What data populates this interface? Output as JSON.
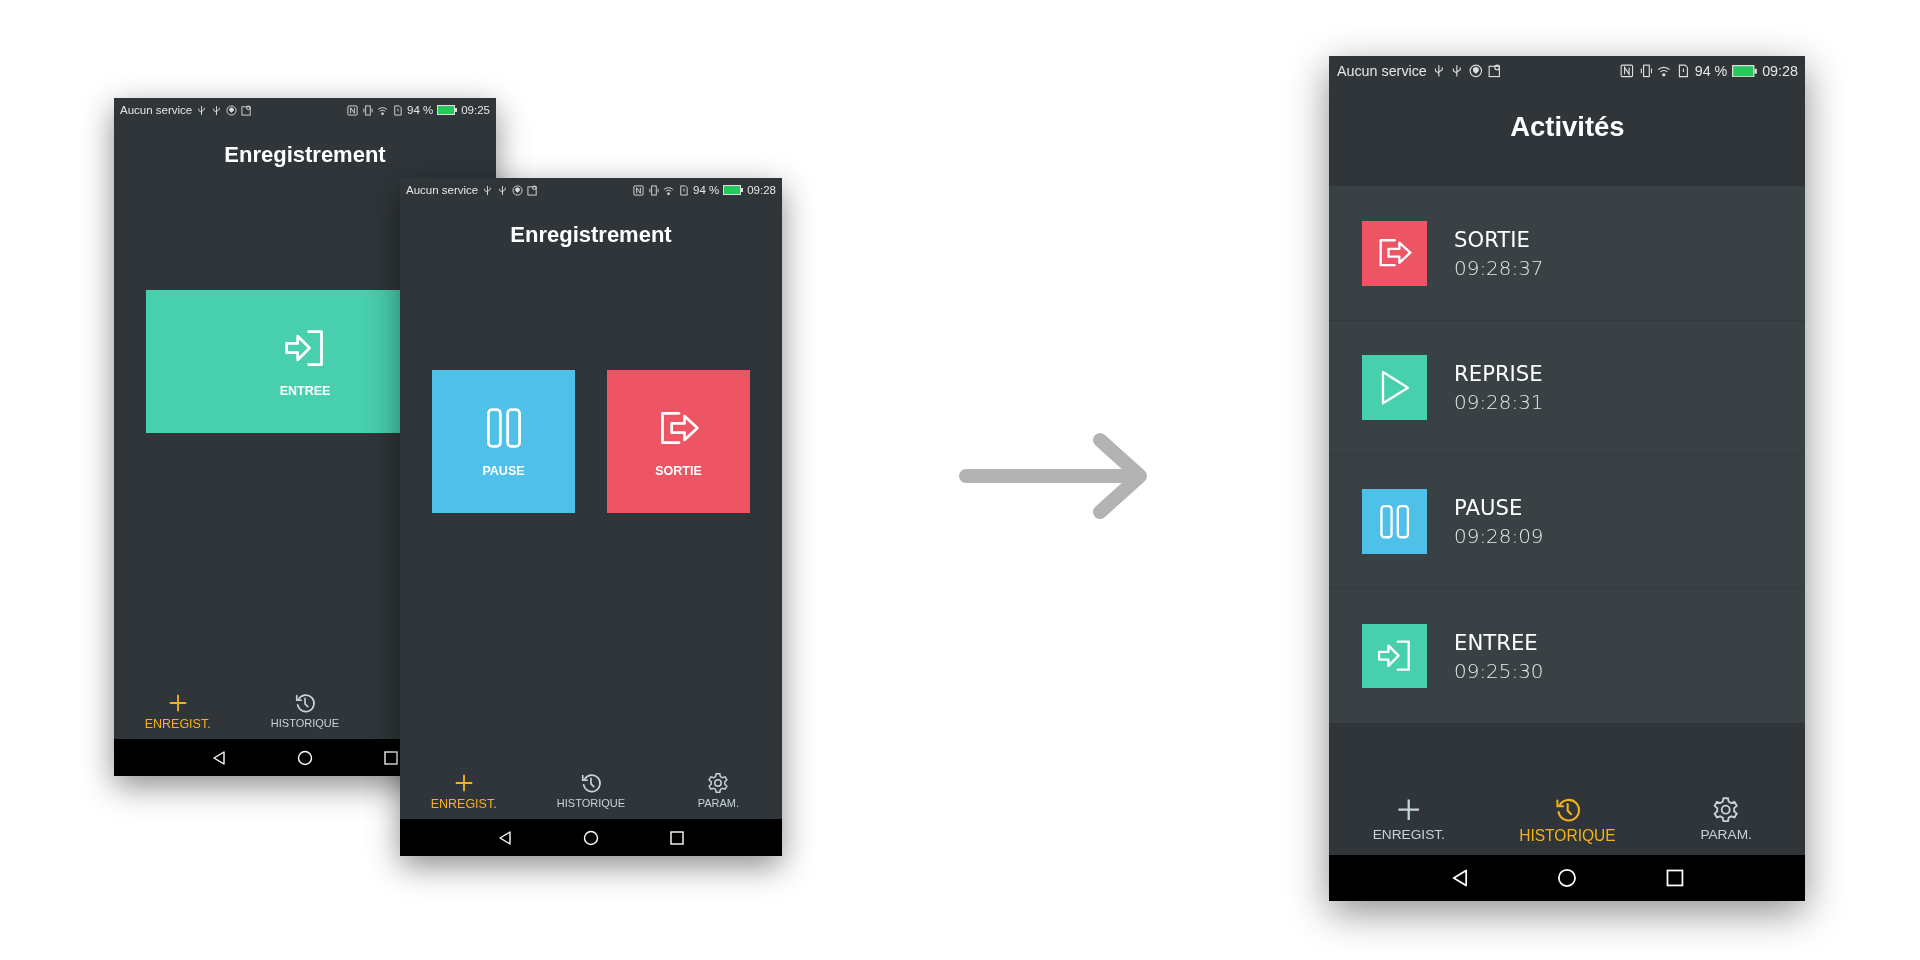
{
  "screens": [
    {
      "status_bar": {
        "carrier": "Aucun service",
        "battery": "94 %",
        "time": "09:25"
      },
      "title": "Enregistrement",
      "actions": [
        {
          "kind": "entry",
          "label": "ENTREE"
        }
      ],
      "nav": [
        {
          "kind": "add",
          "label": "ENREGIST.",
          "selected": true
        },
        {
          "kind": "history",
          "label": "HISTORIQUE",
          "selected": false
        }
      ]
    },
    {
      "status_bar": {
        "carrier": "Aucun service",
        "battery": "94 %",
        "time": "09:28"
      },
      "title": "Enregistrement",
      "actions": [
        {
          "kind": "pause",
          "label": "PAUSE"
        },
        {
          "kind": "exit",
          "label": "SORTIE"
        }
      ],
      "nav": [
        {
          "kind": "add",
          "label": "ENREGIST.",
          "selected": true
        },
        {
          "kind": "history",
          "label": "HISTORIQUE",
          "selected": false
        },
        {
          "kind": "settings",
          "label": "PARAM.",
          "selected": false
        }
      ]
    },
    {
      "status_bar": {
        "carrier": "Aucun service",
        "battery": "94 %",
        "time": "09:28"
      },
      "title": "Activités",
      "activities": [
        {
          "kind": "exit",
          "name": "SORTIE",
          "time": "09:28:37"
        },
        {
          "kind": "resume",
          "name": "REPRISE",
          "time": "09:28:31"
        },
        {
          "kind": "pause",
          "name": "PAUSE",
          "time": "09:28:09"
        },
        {
          "kind": "entry",
          "name": "ENTREE",
          "time": "09:25:30"
        }
      ],
      "nav": [
        {
          "kind": "add",
          "label": "ENREGIST.",
          "selected": false
        },
        {
          "kind": "history",
          "label": "HISTORIQUE",
          "selected": true
        },
        {
          "kind": "settings",
          "label": "PARAM.",
          "selected": false
        }
      ]
    }
  ]
}
